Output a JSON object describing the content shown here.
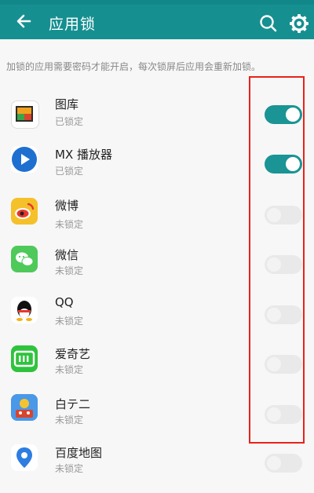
{
  "header": {
    "title": "应用锁"
  },
  "description": "加锁的应用需要密码才能开启，每次锁屏后应用会重新加锁。",
  "apps": [
    {
      "name": "图库",
      "status": "已锁定",
      "locked": true,
      "icon": "gallery-icon"
    },
    {
      "name": "MX 播放器",
      "status": "已锁定",
      "locked": true,
      "icon": "mx-player-icon"
    },
    {
      "name": "微博",
      "status": "未锁定",
      "locked": false,
      "icon": "weibo-icon"
    },
    {
      "name": "微信",
      "status": "未锁定",
      "locked": false,
      "icon": "wechat-icon"
    },
    {
      "name": "QQ",
      "status": "未锁定",
      "locked": false,
      "icon": "qq-icon"
    },
    {
      "name": "爱奇艺",
      "status": "未锁定",
      "locked": false,
      "icon": "iqiyi-icon"
    },
    {
      "name": "白テ二",
      "status": "未锁定",
      "locked": false,
      "icon": "game-icon"
    },
    {
      "name": "百度地图",
      "status": "未锁定",
      "locked": false,
      "icon": "baidu-map-icon"
    }
  ],
  "colors": {
    "appbar": "#168f90",
    "toggle_on": "#1a9494",
    "highlight": "#e8221c"
  },
  "icons": {
    "back": "back-arrow-icon",
    "search": "search-icon",
    "settings": "gear-icon"
  }
}
